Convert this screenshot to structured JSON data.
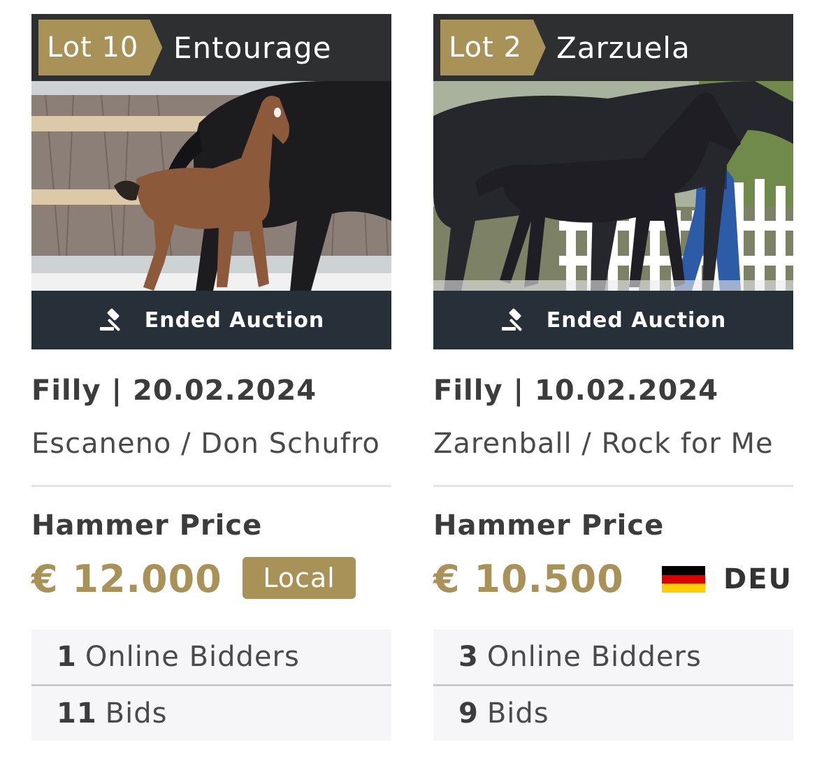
{
  "colors": {
    "gold": "#a99257",
    "dark_header": "#2e2f31",
    "ended_bar": "#273038"
  },
  "cards": [
    {
      "lot_label": "Lot 10",
      "name": "Entourage",
      "status_icon": "gavel-icon",
      "status": "Ended Auction",
      "meta": "Filly | 20.02.2024",
      "pedigree": "Escaneno / Don Schufro",
      "hammer_label": "Hammer Price",
      "price": "€ 12.000",
      "buyer_badge": "Local",
      "online_bidders_count": "1",
      "online_bidders_label": "Online Bidders",
      "bids_count": "11",
      "bids_label": "Bids"
    },
    {
      "lot_label": "Lot 2",
      "name": "Zarzuela",
      "status_icon": "gavel-icon",
      "status": "Ended Auction",
      "meta": "Filly | 10.02.2024",
      "pedigree": "Zarenball / Rock for Me",
      "hammer_label": "Hammer Price",
      "price": "€ 10.500",
      "buyer_flag": "germany-flag-icon",
      "buyer_country": "DEU",
      "online_bidders_count": "3",
      "online_bidders_label": "Online Bidders",
      "bids_count": "9",
      "bids_label": "Bids"
    }
  ]
}
